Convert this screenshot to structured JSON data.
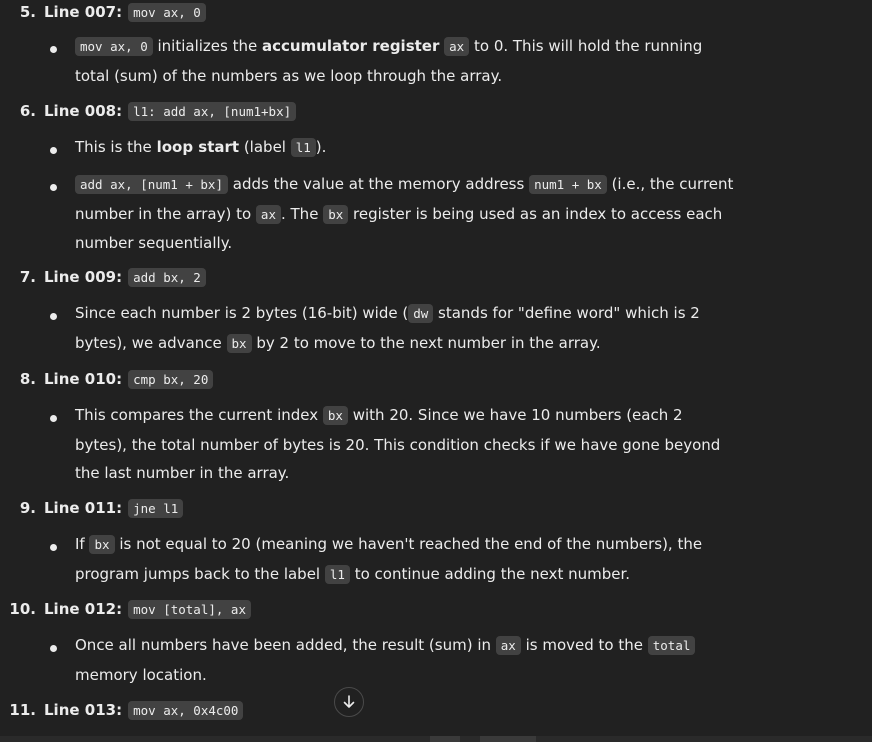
{
  "items": [
    {
      "num": "5.",
      "title": "Line 007:",
      "code": "mov ax, 0",
      "bullets": [
        [
          {
            "t": "code",
            "v": "mov ax, 0"
          },
          {
            "t": "text",
            "v": " initializes the "
          },
          {
            "t": "bold",
            "v": "accumulator register"
          },
          {
            "t": "text",
            "v": " "
          },
          {
            "t": "code",
            "v": "ax"
          },
          {
            "t": "text",
            "v": " to 0. This will hold the running total (sum) of the numbers as we loop through the array."
          }
        ]
      ]
    },
    {
      "num": "6.",
      "title": "Line 008:",
      "code": "l1: add ax, [num1+bx]",
      "bullets": [
        [
          {
            "t": "text",
            "v": "This is the "
          },
          {
            "t": "bold",
            "v": "loop start"
          },
          {
            "t": "text",
            "v": " (label "
          },
          {
            "t": "code",
            "v": "l1"
          },
          {
            "t": "text",
            "v": ")."
          }
        ],
        [
          {
            "t": "code",
            "v": "add ax, [num1 + bx]"
          },
          {
            "t": "text",
            "v": " adds the value at the memory address "
          },
          {
            "t": "code",
            "v": "num1 + bx"
          },
          {
            "t": "text",
            "v": " (i.e., the current number in the array) to "
          },
          {
            "t": "code",
            "v": "ax"
          },
          {
            "t": "text",
            "v": ". The "
          },
          {
            "t": "code",
            "v": "bx"
          },
          {
            "t": "text",
            "v": " register is being used as an index to access each number sequentially."
          }
        ]
      ]
    },
    {
      "num": "7.",
      "title": "Line 009:",
      "code": "add bx, 2",
      "bullets": [
        [
          {
            "t": "text",
            "v": "Since each number is 2 bytes (16-bit) wide ("
          },
          {
            "t": "code",
            "v": "dw"
          },
          {
            "t": "text",
            "v": " stands for \"define word\" which is 2 bytes), we advance "
          },
          {
            "t": "code",
            "v": "bx"
          },
          {
            "t": "text",
            "v": " by 2 to move to the next number in the array."
          }
        ]
      ]
    },
    {
      "num": "8.",
      "title": "Line 010:",
      "code": "cmp bx, 20",
      "bullets": [
        [
          {
            "t": "text",
            "v": "This compares the current index "
          },
          {
            "t": "code",
            "v": "bx"
          },
          {
            "t": "text",
            "v": " with 20. Since we have 10 numbers (each 2 bytes), the total number of bytes is 20. This condition checks if we have gone beyond the last number in the array."
          }
        ]
      ]
    },
    {
      "num": "9.",
      "title": "Line 011:",
      "code": "jne l1",
      "bullets": [
        [
          {
            "t": "text",
            "v": "If "
          },
          {
            "t": "code",
            "v": "bx"
          },
          {
            "t": "text",
            "v": " is not equal to 20 (meaning we haven't reached the end of the numbers), the program jumps back to the label "
          },
          {
            "t": "code",
            "v": "l1"
          },
          {
            "t": "text",
            "v": " to continue adding the next number."
          }
        ]
      ]
    },
    {
      "num": "10.",
      "title": "Line 012:",
      "code": "mov [total], ax",
      "bullets": [
        [
          {
            "t": "text",
            "v": "Once all numbers have been added, the result (sum) in "
          },
          {
            "t": "code",
            "v": "ax"
          },
          {
            "t": "text",
            "v": " is moved to the "
          },
          {
            "t": "code",
            "v": "total"
          },
          {
            "t": "text",
            "v": " memory location."
          }
        ]
      ]
    },
    {
      "num": "11.",
      "title": "Line 013:",
      "code": "mov ax, 0x4c00",
      "bullets": []
    }
  ],
  "scroll_button": {
    "icon": "arrow-down-icon"
  },
  "colors": {
    "background": "#212121",
    "text": "#ececec",
    "code_background": "#424242"
  }
}
